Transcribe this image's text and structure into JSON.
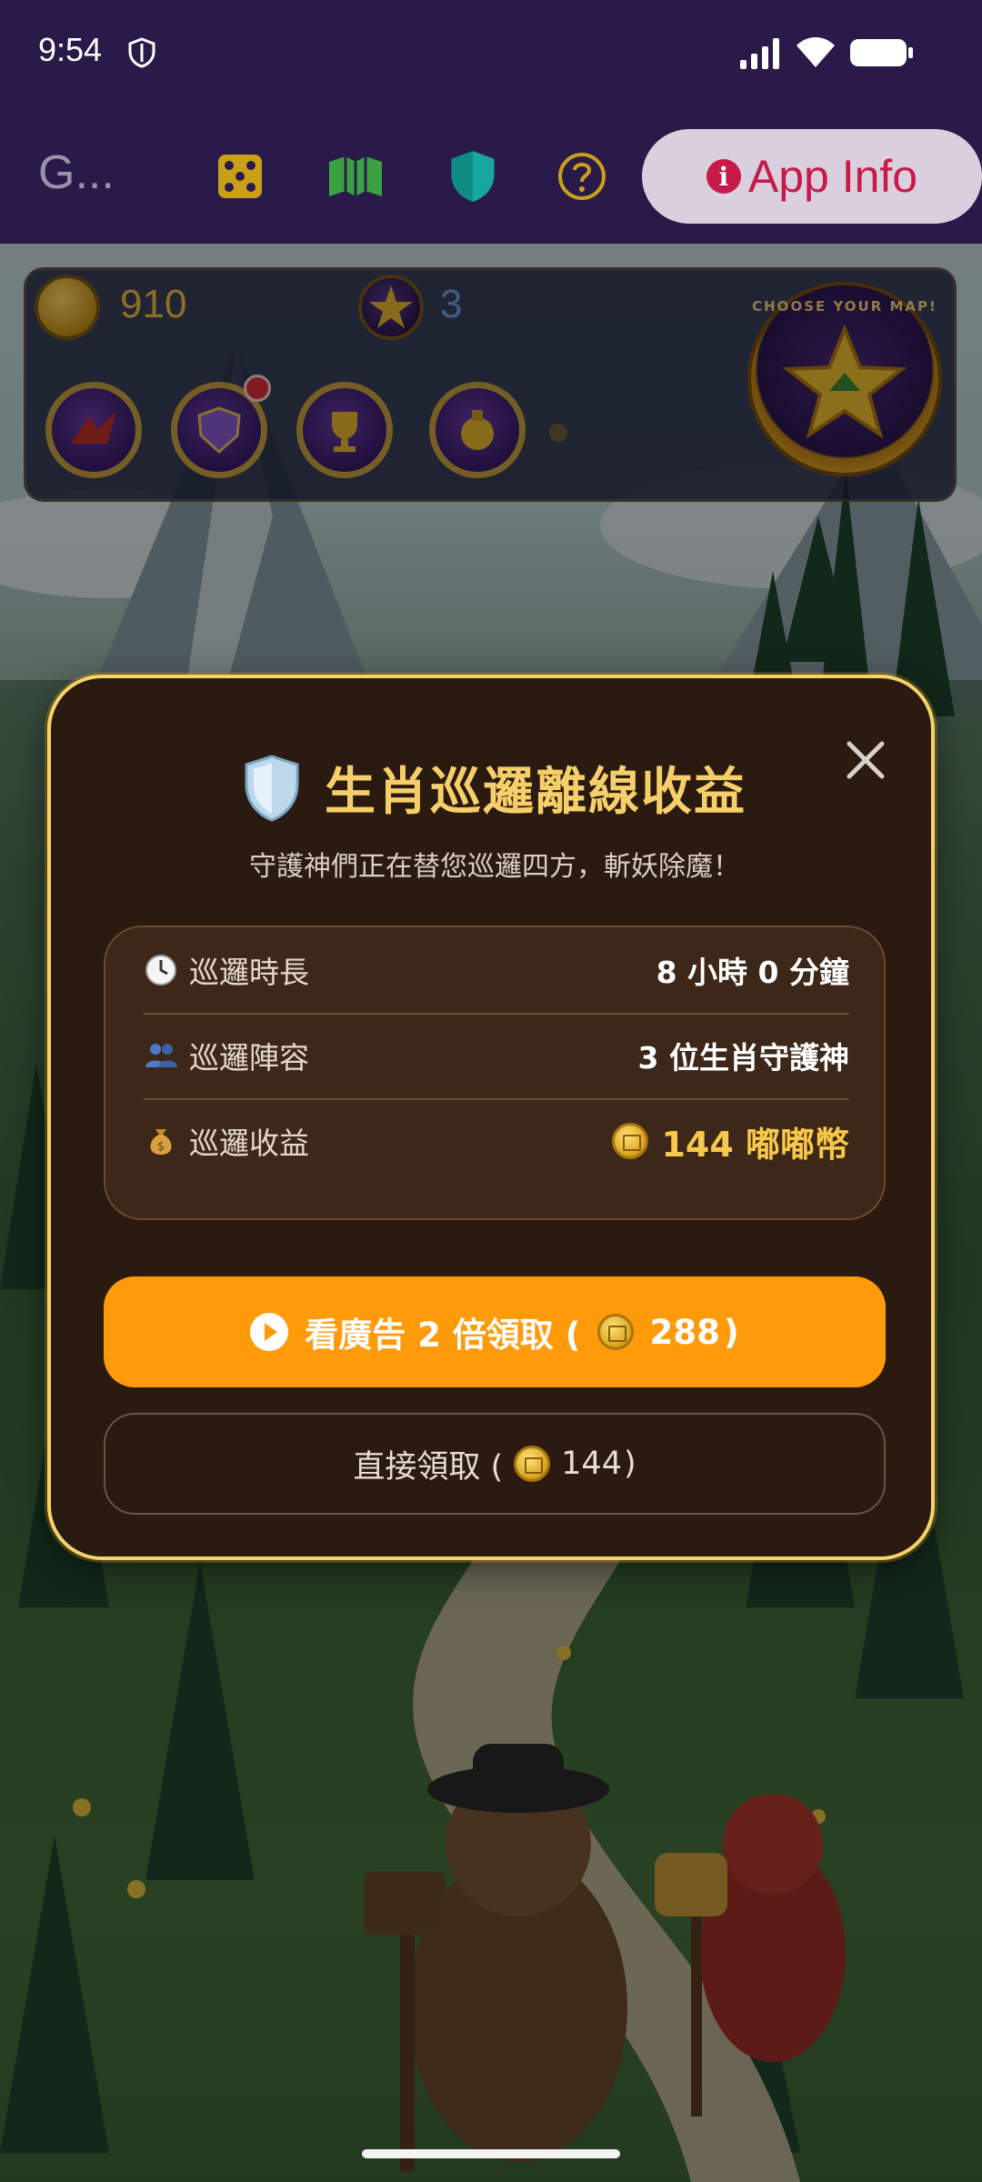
{
  "status_bar": {
    "time": "9:54"
  },
  "app_bar": {
    "title": "G...",
    "app_info_label": "App Info"
  },
  "hud": {
    "coins": "910",
    "stars": "3",
    "map_badge_text": "CHOOSE YOUR MAP!"
  },
  "dialog": {
    "title": "生肖巡邏離線收益",
    "subtitle": "守護神們正在替您巡邏四方，斬妖除魔！",
    "rows": [
      {
        "icon": "clock-icon",
        "label": "巡邏時長",
        "value": "8 小時 0 分鐘"
      },
      {
        "icon": "people-icon",
        "label": "巡邏陣容",
        "value": "3 位生肖守護神"
      },
      {
        "icon": "money-bag-icon",
        "label": "巡邏收益",
        "value": "144 嘟嘟幣"
      }
    ],
    "primary_button": {
      "label_prefix": "看廣告 2 倍領取 (",
      "amount": "288",
      "label_suffix": ")"
    },
    "secondary_button": {
      "label_prefix": "直接領取 (",
      "amount": "144",
      "label_suffix": ")"
    }
  },
  "colors": {
    "app_bar_bg": "#2a1a4a",
    "dialog_bg": "#2a1a10",
    "dialog_border": "#f5d36a",
    "title_gold": "#f7cf6a",
    "primary_button": "#ff9a0a",
    "app_info_text": "#c71a4a"
  }
}
